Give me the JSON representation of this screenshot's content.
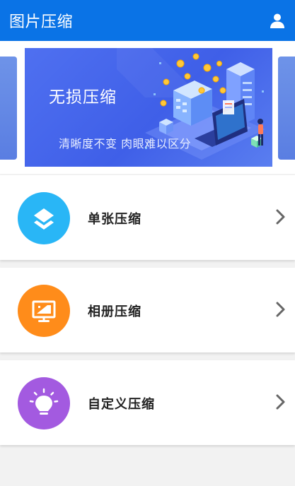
{
  "app": {
    "title": "图片压缩",
    "bar_color": "#0a73e6",
    "user_icon": "user-icon"
  },
  "banner": {
    "title": "无损压缩",
    "subtitle": "清晰度不变 肉眼难以区分",
    "background": "#4f70f0"
  },
  "options": [
    {
      "label": "单张压缩",
      "icon": "layers-icon",
      "color": "#29b6f6"
    },
    {
      "label": "相册压缩",
      "icon": "image-frame-icon",
      "color": "#ff8c1a"
    },
    {
      "label": "自定义压缩",
      "icon": "lightbulb-icon",
      "color": "#a35ae0"
    }
  ]
}
